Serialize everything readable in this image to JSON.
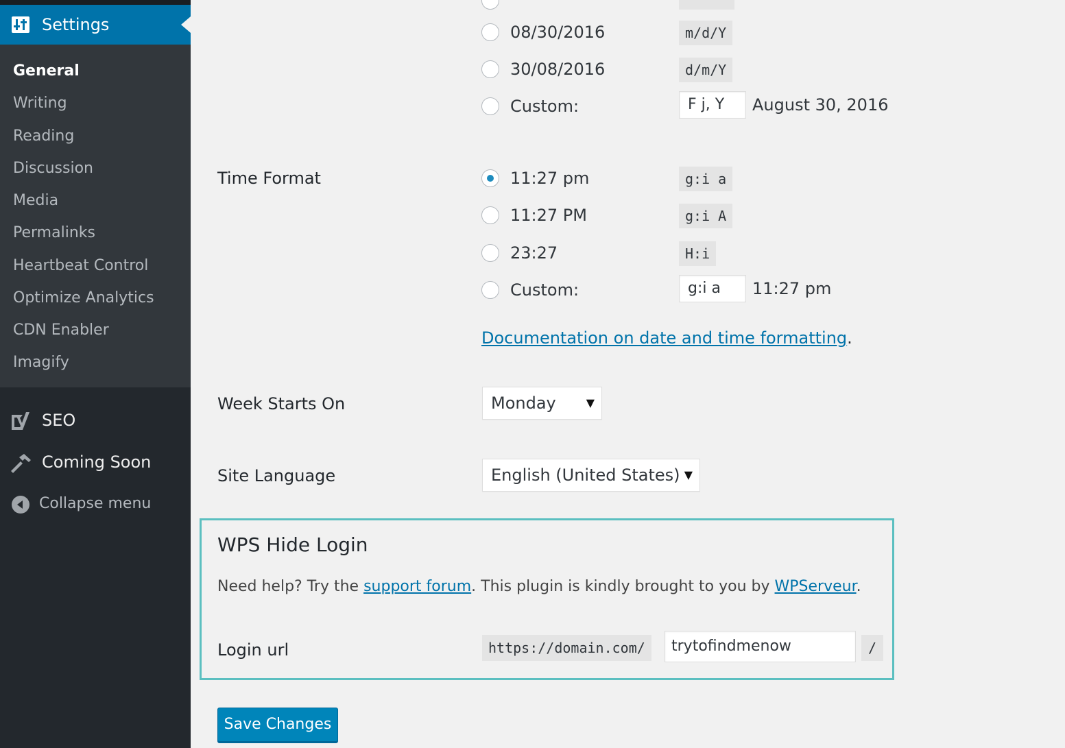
{
  "sidebar": {
    "settings_label": "Settings",
    "submenu": [
      "General",
      "Writing",
      "Reading",
      "Discussion",
      "Media",
      "Permalinks",
      "Heartbeat Control",
      "Optimize Analytics",
      "CDN Enabler",
      "Imagify"
    ],
    "seo_label": "SEO",
    "coming_soon_label": "Coming Soon",
    "collapse_label": "Collapse menu"
  },
  "date_format": {
    "options": [
      {
        "label": "08/30/2016",
        "code": "m/d/Y"
      },
      {
        "label": "30/08/2016",
        "code": "d/m/Y"
      },
      {
        "label": "Custom:",
        "value": "F j, Y",
        "preview": "August 30, 2016"
      }
    ]
  },
  "time_format": {
    "label": "Time Format",
    "options": [
      {
        "label": "11:27 pm",
        "code": "g:i a",
        "checked": true
      },
      {
        "label": "11:27 PM",
        "code": "g:i A"
      },
      {
        "label": "23:27",
        "code": "H:i"
      },
      {
        "label": "Custom:",
        "value": "g:i a",
        "preview": "11:27 pm"
      }
    ],
    "doc_link": "Documentation on date and time formatting",
    "doc_suffix": "."
  },
  "week_starts": {
    "label": "Week Starts On",
    "value": "Monday"
  },
  "site_language": {
    "label": "Site Language",
    "value": "English (United States)"
  },
  "wps": {
    "title": "WPS Hide Login",
    "help_prefix": "Need help? Try the ",
    "support_link": "support forum",
    "help_middle": ". This plugin is kindly brought to you by ",
    "author_link": "WPServeur",
    "help_suffix": ".",
    "login_url_label": "Login url",
    "url_prefix": "https://domain.com/",
    "url_value": "trytofindmenow",
    "url_suffix": "/"
  },
  "save_button": "Save Changes",
  "colors": {
    "accent": "#0073aa",
    "sidebar": "#23282d",
    "highlight_border": "#5bbfc0"
  }
}
